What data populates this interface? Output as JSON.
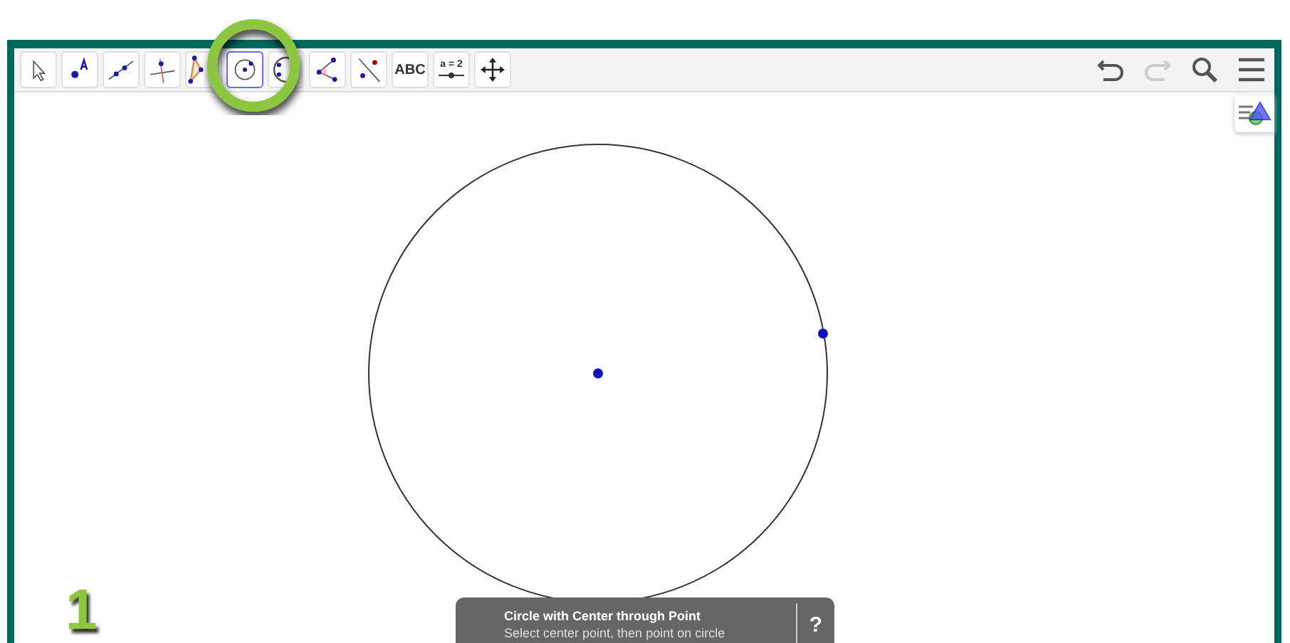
{
  "toolbar": {
    "tools": [
      {
        "kind": "move",
        "selected": false
      },
      {
        "kind": "point",
        "selected": false
      },
      {
        "kind": "line",
        "selected": false
      },
      {
        "kind": "perpendicular",
        "selected": false
      },
      {
        "kind": "polygon",
        "selected": false
      },
      {
        "kind": "circle",
        "selected": true
      },
      {
        "kind": "circle3",
        "selected": false
      },
      {
        "kind": "angle",
        "selected": false
      },
      {
        "kind": "reflect",
        "selected": false
      },
      {
        "kind": "text",
        "text": "ABC",
        "selected": false
      },
      {
        "kind": "slider",
        "text": "a = 2",
        "selected": false
      },
      {
        "kind": "pan",
        "selected": false
      }
    ],
    "undo": {
      "disabled": false
    },
    "redo": {
      "disabled": true
    }
  },
  "canvas": {
    "annotation": "1"
  },
  "tooltip": {
    "title": "Circle with Center through Point",
    "description": "Select center point, then point on circle",
    "help": "?"
  }
}
